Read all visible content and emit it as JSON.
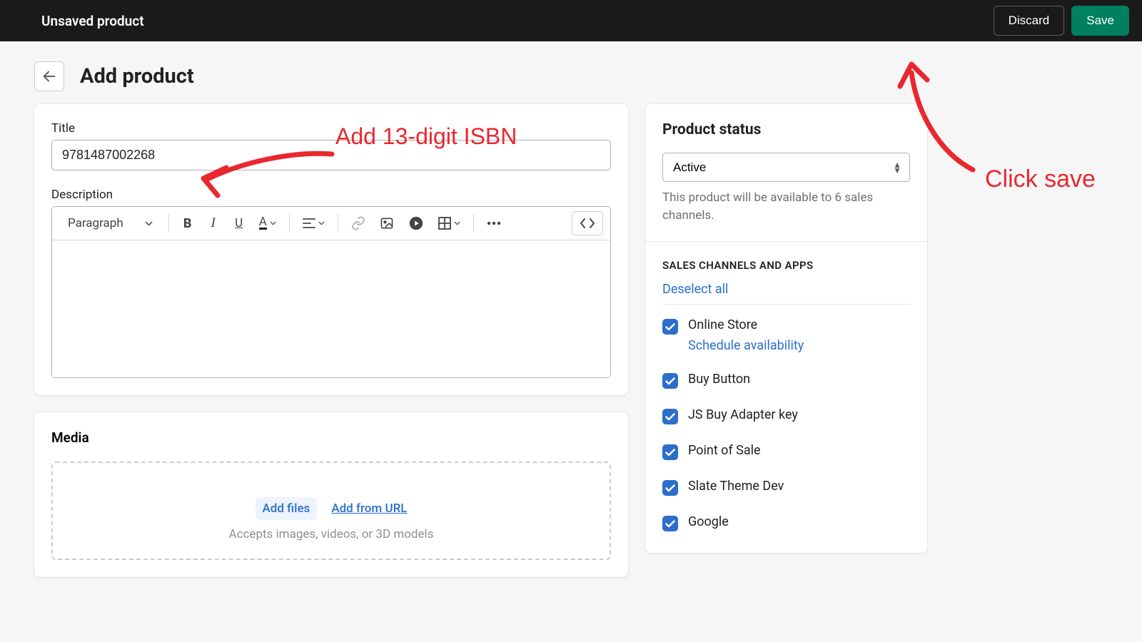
{
  "topbar": {
    "title": "Unsaved product",
    "discard": "Discard",
    "save": "Save"
  },
  "page": {
    "title": "Add product"
  },
  "main": {
    "title_label": "Title",
    "title_value": "9781487002268",
    "description_label": "Description",
    "rte": {
      "style_selected": "Paragraph"
    },
    "media_title": "Media",
    "add_files": "Add files",
    "add_from_url": "Add from URL",
    "media_help": "Accepts images, videos, or 3D models"
  },
  "side": {
    "status_title": "Product status",
    "status_value": "Active",
    "status_help": "This product will be available to 6 sales channels.",
    "channels_title": "SALES CHANNELS AND APPS",
    "deselect": "Deselect all",
    "schedule": "Schedule availability",
    "items": [
      {
        "label": "Online Store",
        "schedule": true
      },
      {
        "label": "Buy Button"
      },
      {
        "label": "JS Buy Adapter key"
      },
      {
        "label": "Point of Sale"
      },
      {
        "label": "Slate Theme Dev"
      },
      {
        "label": "Google"
      }
    ]
  },
  "annotations": {
    "isbn": "Add 13-digit ISBN",
    "save": "Click save"
  }
}
